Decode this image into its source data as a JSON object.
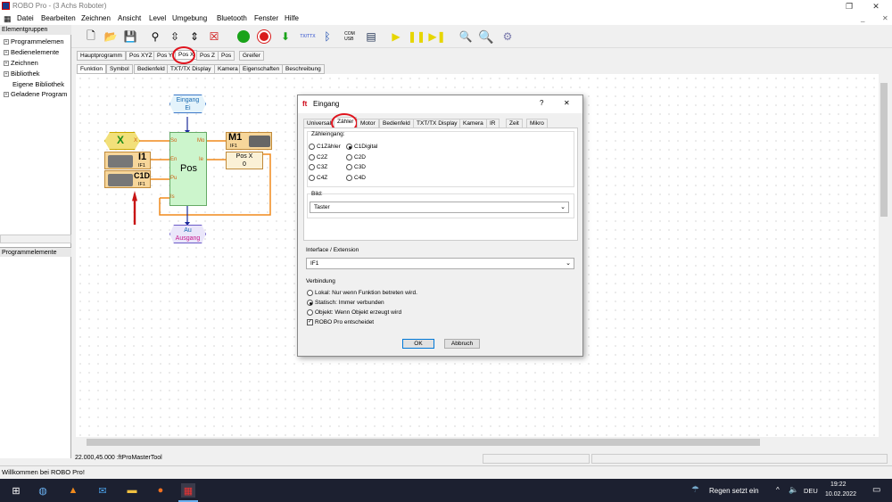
{
  "window": {
    "title": "ROBO Pro - (3 Achs Roboter)"
  },
  "menu": [
    "Datei",
    "Bearbeiten",
    "Zeichnen",
    "Ansicht",
    "Level",
    "Umgebung",
    "Bluetooth",
    "Fenster",
    "Hilfe"
  ],
  "toolbar": {
    "com_usb_label": "COM\nUSB",
    "ttx_label": "TX/TTX"
  },
  "left_panel": {
    "header": "Elementgruppen",
    "items": [
      "Programmelemen",
      "Bedienelemente",
      "Zeichnen",
      "Bibliothek",
      "Eigene Bibliothek",
      "Geladene Program"
    ],
    "program_header": "Programmelemente"
  },
  "program_tabs": [
    "Hauptprogramm",
    "Pos XYZ",
    "Pos Y",
    "Pos X",
    "Pos Z",
    "Pos",
    "Greifer"
  ],
  "view_tabs": [
    "Funktion",
    "Symbol",
    "Bedienfeld",
    "TXT/TX Display",
    "Kamera",
    "Eigenschaften",
    "Beschreibung"
  ],
  "diagram": {
    "eingang_line1": "Eingang",
    "eingang_line2": "Ei",
    "x_label": "X",
    "x_port": "X",
    "i1_label": "I1",
    "i1_sub": "IF1",
    "c1d_label": "C1D",
    "c1d_sub": "IF1",
    "pos_label": "Pos",
    "ports_left": [
      "So",
      "En",
      "Pu",
      "Is"
    ],
    "ports_right": [
      "Mo",
      "Ie"
    ],
    "m1_label": "M1",
    "m1_sub": "IF1",
    "posx_label": "Pos X",
    "posx_value": "0",
    "ausgang_line1": "Au",
    "ausgang_line2": "Ausgang"
  },
  "dialog": {
    "title": "Eingang",
    "help": "?",
    "close": "✕",
    "tabs": [
      "Universal",
      "Zähler",
      "Motor",
      "Bedienfeld",
      "TXT/TX Display",
      "Kamera",
      "IR",
      "Zeit",
      "Mikro"
    ],
    "counter_group": "Zähleingang:",
    "counters": [
      [
        "C1Zähler",
        "C1Digital"
      ],
      [
        "C2Z",
        "C2D"
      ],
      [
        "C3Z",
        "C3D"
      ],
      [
        "C4Z",
        "C4D"
      ]
    ],
    "picture_group": "Bild:",
    "picture_value": "Taster",
    "interface_label": "Interface / Extension",
    "interface_value": "IF1",
    "connection_label": "Verbindung",
    "connections": [
      "Lokal: Nur wenn Funktion betreten wird.",
      "Statisch: Immer verbunden",
      "Objekt: Wenn Objekt erzeugt wird"
    ],
    "checkbox_label": "ROBO Pro entscheidet",
    "ok": "OK",
    "cancel": "Abbruch"
  },
  "status": {
    "coords": "22.000,45.000 :ftProMasterTool",
    "message": "Willkommen bei ROBO Pro!"
  },
  "taskbar": {
    "weather": "Regen setzt ein",
    "lang": "DEU",
    "time": "19:22",
    "date": "10.02.2022"
  }
}
